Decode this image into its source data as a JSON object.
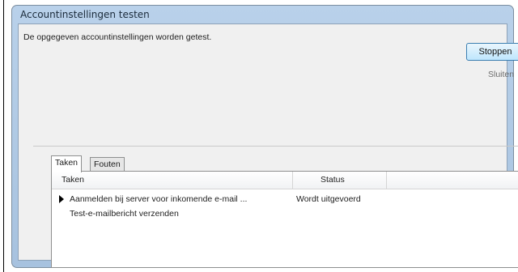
{
  "window": {
    "title": "Accountinstellingen testen",
    "message": "De opgegeven accountinstellingen worden getest."
  },
  "buttons": {
    "stop_label": "Stoppen",
    "close_label": "Sluiten"
  },
  "tabs": [
    {
      "label": "Taken",
      "active": true
    },
    {
      "label": "Fouten",
      "active": false
    }
  ],
  "table": {
    "columns": [
      "Taken",
      "Status"
    ],
    "rows": [
      {
        "task": "Aanmelden bij server voor inkomende e-mail ...",
        "status": "Wordt uitgevoerd",
        "current": true
      },
      {
        "task": "Test-e-mailbericht verzenden",
        "status": "",
        "current": false
      }
    ]
  }
}
